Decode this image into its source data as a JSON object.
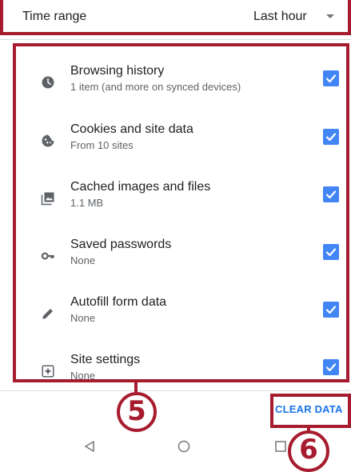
{
  "time_range": {
    "label": "Time range",
    "value": "Last hour"
  },
  "items": [
    {
      "title": "Browsing history",
      "subtitle": "1 item (and more on synced devices)",
      "icon": "clock-icon",
      "checked": true
    },
    {
      "title": "Cookies and site data",
      "subtitle": "From 10 sites",
      "icon": "cookie-icon",
      "checked": true
    },
    {
      "title": "Cached images and files",
      "subtitle": "1.1 MB",
      "icon": "image-icon",
      "checked": true
    },
    {
      "title": "Saved passwords",
      "subtitle": "None",
      "icon": "key-icon",
      "checked": true
    },
    {
      "title": "Autofill form data",
      "subtitle": "None",
      "icon": "pencil-icon",
      "checked": true
    },
    {
      "title": "Site settings",
      "subtitle": "None",
      "icon": "settings-icon",
      "checked": true
    }
  ],
  "action": {
    "clear_label": "CLEAR DATA"
  },
  "annotations": {
    "list_step": "5",
    "button_step": "6"
  },
  "colors": {
    "accent": "#1a73e8",
    "checkbox": "#4285f4",
    "annotation": "#a61c2e",
    "icon": "#5f6368"
  },
  "nav": {
    "back": "back-icon",
    "home": "home-icon",
    "recents": "recents-icon"
  }
}
